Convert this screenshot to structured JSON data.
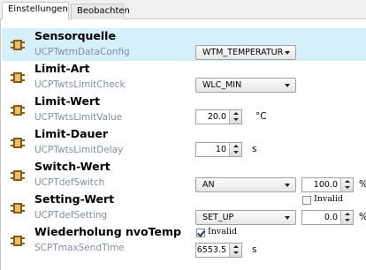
{
  "tabs": [
    {
      "label": "Einstellungen",
      "active": true
    },
    {
      "label": "Beobachten",
      "active": false
    }
  ],
  "icon": "connector-icon",
  "colors": {
    "selected_row": "#d6f0fb",
    "subtitle": "#7f8fa8",
    "icon": "#8b5a0a"
  },
  "rows": [
    {
      "title": "Sensorquelle",
      "property": "UCPTwtmDataConfig",
      "combo": "WTM_TEMPERATUR"
    },
    {
      "title": "Limit-Art",
      "property": "UCPTwtsLimitCheck",
      "combo": "WLC_MIN"
    },
    {
      "title": "Limit-Wert",
      "property": "UCPTwtsLimitValue",
      "value": "20.0",
      "unit": "°C"
    },
    {
      "title": "Limit-Dauer",
      "property": "UCPTwtsLimitDelay",
      "value": "10",
      "unit": "s"
    },
    {
      "title": "Switch-Wert",
      "property": "UCPTdefSwitch",
      "combo": "AN",
      "value": "100.0",
      "unit": "%"
    },
    {
      "title": "Setting-Wert",
      "property": "UCPTdefSetting",
      "combo": "SET_UP",
      "value": "0.0",
      "unit": "%",
      "checkbox_label": "Invalid",
      "checkbox_checked": false
    },
    {
      "title": "Wiederholung nvoTemp",
      "property": "SCPTmaxSendTime",
      "value": "6553.5",
      "unit": "s",
      "checkbox_label": "Invalid",
      "checkbox_checked": true
    }
  ]
}
